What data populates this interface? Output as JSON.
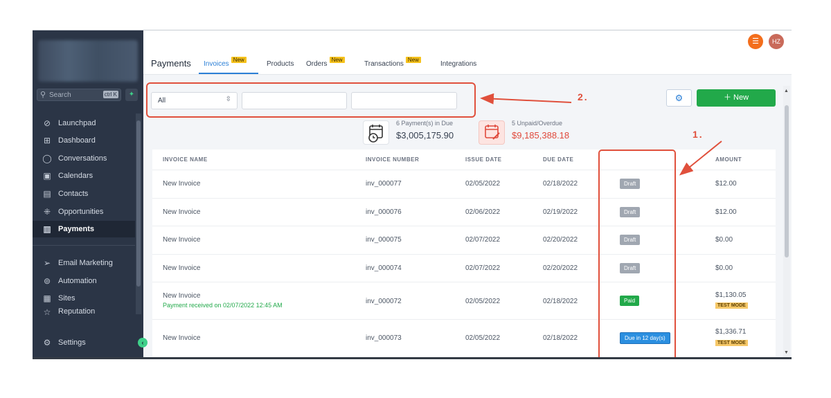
{
  "sidebar": {
    "search_placeholder": "Search",
    "search_shortcut": "ctrl K",
    "items": [
      {
        "label": "Launchpad",
        "icon": "rocket-icon"
      },
      {
        "label": "Dashboard",
        "icon": "dashboard-icon"
      },
      {
        "label": "Conversations",
        "icon": "chat-icon"
      },
      {
        "label": "Calendars",
        "icon": "calendar-icon"
      },
      {
        "label": "Contacts",
        "icon": "contacts-icon"
      },
      {
        "label": "Opportunities",
        "icon": "opportunities-icon"
      },
      {
        "label": "Payments",
        "icon": "payments-icon",
        "active": true
      },
      {
        "label": "Email Marketing",
        "icon": "send-icon"
      },
      {
        "label": "Automation",
        "icon": "automation-icon"
      },
      {
        "label": "Sites",
        "icon": "sites-icon"
      },
      {
        "label": "Reputation",
        "icon": "star-icon"
      }
    ],
    "settings_label": "Settings"
  },
  "header": {
    "avatar_initials": "HZ",
    "title": "Payments",
    "tabs": [
      {
        "label": "Invoices",
        "badge": "New",
        "active": true
      },
      {
        "label": "Products"
      },
      {
        "label": "Orders",
        "badge": "New"
      },
      {
        "label": "Transactions",
        "badge": "New"
      },
      {
        "label": "Integrations"
      }
    ]
  },
  "filters": {
    "status_value": "All",
    "new_button": "New"
  },
  "annotations": {
    "label_1": "1.",
    "label_2": "2."
  },
  "summary": {
    "due_caption": "6 Payment(s) in Due",
    "due_amount": "$3,005,175.90",
    "overdue_caption": "5 Unpaid/Overdue",
    "overdue_amount": "$9,185,388.18"
  },
  "table": {
    "headers": {
      "name": "INVOICE NAME",
      "number": "INVOICE NUMBER",
      "issue": "ISSUE DATE",
      "due": "DUE DATE",
      "amount": "AMOUNT"
    },
    "rows": [
      {
        "name": "New Invoice",
        "note": "",
        "number": "inv_000077",
        "issue": "02/05/2022",
        "due": "02/18/2022",
        "status": "Draft",
        "amount": "$12.00",
        "tag": ""
      },
      {
        "name": "New Invoice",
        "note": "",
        "number": "inv_000076",
        "issue": "02/06/2022",
        "due": "02/19/2022",
        "status": "Draft",
        "amount": "$12.00",
        "tag": ""
      },
      {
        "name": "New Invoice",
        "note": "",
        "number": "inv_000075",
        "issue": "02/07/2022",
        "due": "02/20/2022",
        "status": "Draft",
        "amount": "$0.00",
        "tag": ""
      },
      {
        "name": "New Invoice",
        "note": "",
        "number": "inv_000074",
        "issue": "02/07/2022",
        "due": "02/20/2022",
        "status": "Draft",
        "amount": "$0.00",
        "tag": ""
      },
      {
        "name": "New Invoice",
        "note": "Payment received on 02/07/2022 12:45 AM",
        "number": "inv_000072",
        "issue": "02/05/2022",
        "due": "02/18/2022",
        "status": "Paid",
        "amount": "$1,130.05",
        "tag": "TEST MODE"
      },
      {
        "name": "New Invoice",
        "note": "",
        "number": "inv_000073",
        "issue": "02/05/2022",
        "due": "02/18/2022",
        "status": "Due in 12 day(s)",
        "amount": "$1,336.71",
        "tag": "TEST MODE"
      }
    ]
  },
  "colors": {
    "accent": "#2b7fd6",
    "sidebar_bg": "#2b3546",
    "new_button": "#22a94a",
    "annotation": "#e0503c",
    "badge": "#f6c21c"
  }
}
